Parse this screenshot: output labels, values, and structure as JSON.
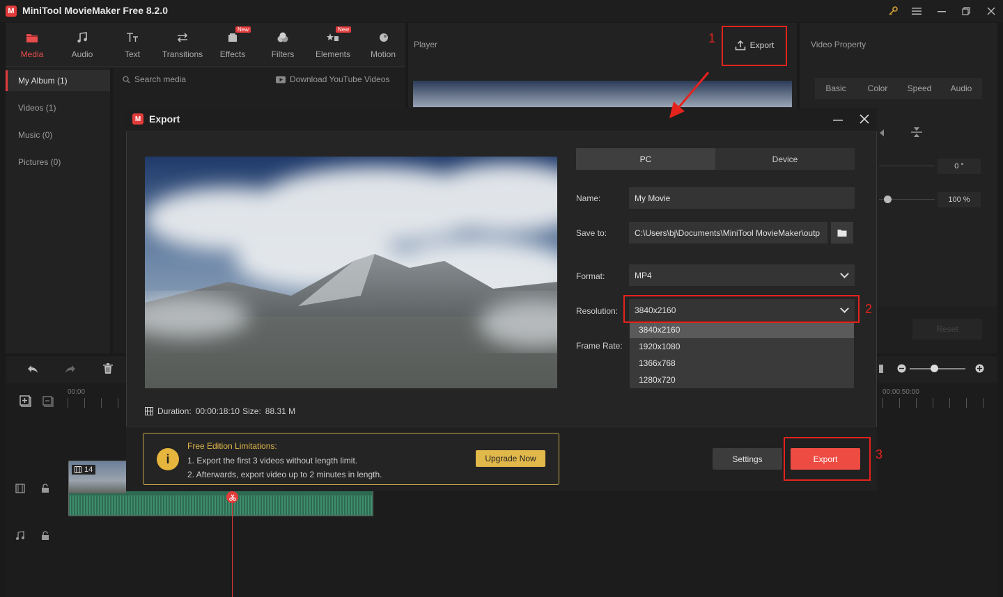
{
  "app": {
    "title": "MiniTool MovieMaker Free 8.2.0"
  },
  "toolbar": {
    "items": [
      {
        "label": "Media",
        "icon": "folder-icon"
      },
      {
        "label": "Audio",
        "icon": "music-icon"
      },
      {
        "label": "Text",
        "icon": "text-icon"
      },
      {
        "label": "Transitions",
        "icon": "transition-icon"
      },
      {
        "label": "Effects",
        "icon": "effects-icon",
        "badge": "New"
      },
      {
        "label": "Filters",
        "icon": "filters-icon"
      },
      {
        "label": "Elements",
        "icon": "elements-icon",
        "badge": "New"
      },
      {
        "label": "Motion",
        "icon": "motion-icon"
      }
    ]
  },
  "sidebar": {
    "items": [
      {
        "label": "My Album (1)"
      },
      {
        "label": "Videos (1)"
      },
      {
        "label": "Music (0)"
      },
      {
        "label": "Pictures (0)"
      }
    ]
  },
  "media": {
    "search_placeholder": "Search media",
    "download": "Download YouTube Videos"
  },
  "player": {
    "label": "Player",
    "export_label": "Export"
  },
  "property": {
    "label": "Video Property",
    "tabs": [
      "Basic",
      "Color",
      "Speed",
      "Audio"
    ],
    "rotation": "0 °",
    "scale": "100 %",
    "reset": "Reset"
  },
  "timeline": {
    "start_time": "00:00",
    "end_time": "00:00:50:00",
    "clip_count": "14"
  },
  "dialog": {
    "title": "Export",
    "tabs": [
      "PC",
      "Device"
    ],
    "name_label": "Name:",
    "name_value": "My Movie",
    "save_label": "Save to:",
    "save_value": "C:\\Users\\bj\\Documents\\MiniTool MovieMaker\\outp",
    "format_label": "Format:",
    "format_value": "MP4",
    "resolution_label": "Resolution:",
    "resolution_value": "3840x2160",
    "resolution_options": [
      "3840x2160",
      "1920x1080",
      "1366x768",
      "1280x720"
    ],
    "framerate_label": "Frame Rate:",
    "duration_label": "Duration:",
    "duration_value": "00:00:18:10",
    "size_label": "Size:",
    "size_value": "88.31 M",
    "limit_title": "Free Edition Limitations:",
    "limit_line1": "1. Export the first 3 videos without length limit.",
    "limit_line2": "2. Afterwards, export video up to 2 minutes in length.",
    "upgrade": "Upgrade Now",
    "settings": "Settings",
    "export": "Export"
  },
  "annotations": {
    "n1": "1",
    "n2": "2",
    "n3": "3"
  },
  "colors": {
    "accent": "#e23b3b",
    "highlight": "#e4231c",
    "export_button": "#ee4b43",
    "gold": "#e1b84a"
  }
}
